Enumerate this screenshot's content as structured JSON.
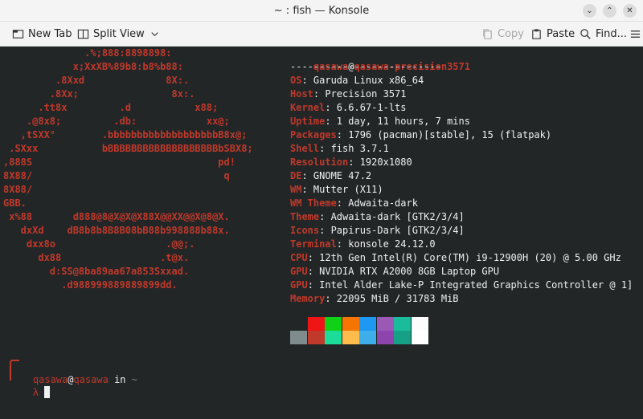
{
  "window": {
    "title": "~ : fish — Konsole",
    "controls": [
      "⌄",
      "⌃",
      "✕"
    ]
  },
  "toolbar": {
    "new_tab": "New Tab",
    "split_view": "Split View",
    "copy": "Copy",
    "paste": "Paste",
    "find": "Find...",
    "menu_icon": "hamburger-menu-icon"
  },
  "terminal": {
    "logo_lines": [
      "              .%;888:8898898:",
      "            x;XxXB%89b8:b8%b88:",
      "         .8Xxd              8X:.",
      "        .8Xx;                8x:.",
      "      .tt8x         .d           x88;",
      "    .@8x8;         .db:            xx@;",
      "   ,tSXX°        .bbbbbbbbbbbbbbbbbbbB8x@;",
      " .SXxx           bBBBBBBBBBBBBBBBBBBBbSBX8;",
      ",888S                                pd!",
      "8X88/                                 q",
      "8X88/",
      "GBB.",
      " x%88       d888@8@X@X@X88X@@XX@@X@8@X.",
      "   dxXd    dB8b8b8B8B08bB88b998888b88x.",
      "    dxx8o                   .@@;.",
      "      dx88                 .t@x.",
      "        d:SS@8ba89aa67a853Sxxad.",
      "          .d988999889889899dd."
    ],
    "user": "qasawa",
    "at": "@",
    "host": "qasawa-precision3571",
    "separator": "--------------------------",
    "info": [
      {
        "key": "OS",
        "value": ": Garuda Linux x86_64"
      },
      {
        "key": "Host",
        "value": ": Precision 3571"
      },
      {
        "key": "Kernel",
        "value": ": 6.6.67-1-lts"
      },
      {
        "key": "Uptime",
        "value": ": 1 day, 11 hours, 7 mins"
      },
      {
        "key": "Packages",
        "value": ": 1796 (pacman)[stable], 15 (flatpak)"
      },
      {
        "key": "Shell",
        "value": ": fish 3.7.1"
      },
      {
        "key": "Resolution",
        "value": ": 1920x1080"
      },
      {
        "key": "DE",
        "value": ": GNOME 47.2"
      },
      {
        "key": "WM",
        "value": ": Mutter (X11)"
      },
      {
        "key": "WM Theme",
        "value": ": Adwaita-dark"
      },
      {
        "key": "Theme",
        "value": ": Adwaita-dark [GTK2/3/4]"
      },
      {
        "key": "Icons",
        "value": ": Papirus-Dark [GTK2/3/4]"
      },
      {
        "key": "Terminal",
        "value": ": konsole 24.12.0"
      },
      {
        "key": "CPU",
        "value": ": 12th Gen Intel(R) Core(TM) i9-12900H (20) @ 5.00 GHz"
      },
      {
        "key": "GPU",
        "value": ": NVIDIA RTX A2000 8GB Laptop GPU"
      },
      {
        "key": "GPU",
        "value": ": Intel Alder Lake-P Integrated Graphics Controller @ 1]"
      },
      {
        "key": "Memory",
        "value": ": 22095 MiB / 31783 MiB"
      }
    ],
    "palette_top": [
      "#232627",
      "#ed1515",
      "#11d116",
      "#f67400",
      "#1d99f3",
      "#9b59b6",
      "#1abc9c",
      "#fcfcfc"
    ],
    "palette_bottom": [
      "#7f8c8d",
      "#c0392b",
      "#1cdc9a",
      "#fdbc4b",
      "#3daee9",
      "#8e44ad",
      "#16a085",
      "#ffffff"
    ],
    "prompt": {
      "user": "qasawa",
      "at": "@",
      "host": "qasawa",
      "in": " in ",
      "dir": "~",
      "lambda": "λ"
    }
  }
}
